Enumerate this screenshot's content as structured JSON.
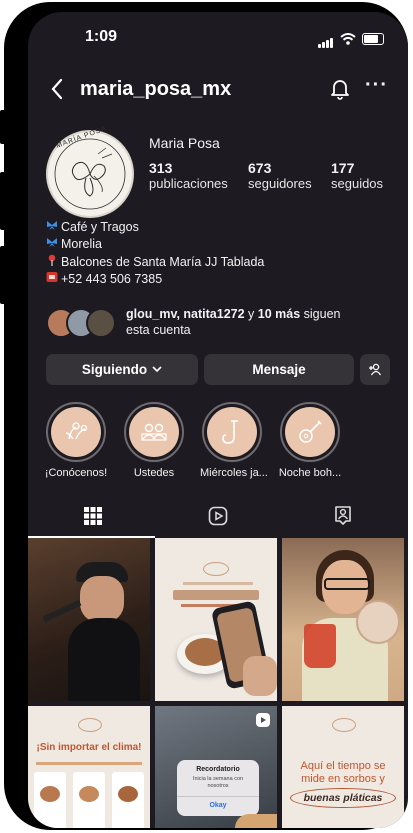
{
  "status_bar": {
    "time": "1:09"
  },
  "header": {
    "username": "maria_posa_mx"
  },
  "profile": {
    "name": "Maria Posa",
    "logo_text": "MARÍA POSA",
    "stats": [
      {
        "count": "313",
        "label": "publicaciones"
      },
      {
        "count": "673",
        "label": "seguidores"
      },
      {
        "count": "177",
        "label": "seguidos"
      }
    ],
    "bio": [
      {
        "icon": "butterfly-icon",
        "text": "Café y Tragos"
      },
      {
        "icon": "butterfly-icon",
        "text": "Morelia"
      },
      {
        "icon": "pin-icon",
        "text": "Balcones de Santa María JJ Tablada"
      },
      {
        "icon": "phone-icon",
        "text": "+52 443 506 7385"
      }
    ],
    "followed_by": {
      "names": "glou_mv, natita1272",
      "connector": " y ",
      "more": "10 más",
      "suffix": " siguen",
      "line2": "esta cuenta"
    }
  },
  "actions": {
    "following_label": "Siguiendo",
    "message_label": "Mensaje"
  },
  "highlights": [
    {
      "label": "¡Conócenos!",
      "icon": "flowers-icon"
    },
    {
      "label": "Ustedes",
      "icon": "people-icon"
    },
    {
      "label": "Miércoles ja...",
      "icon": "saxophone-icon"
    },
    {
      "label": "Noche boh...",
      "icon": "guitar-icon"
    }
  ],
  "tabs": [
    {
      "icon": "grid-icon",
      "active": true
    },
    {
      "icon": "reels-icon",
      "active": false
    },
    {
      "icon": "tagged-icon",
      "active": false
    }
  ],
  "posts": [
    {
      "type": "photo-singer"
    },
    {
      "type": "promo-coffee"
    },
    {
      "type": "photo-woman-drink"
    },
    {
      "type": "promo-weather",
      "headline": "¡Sin importar el clima!"
    },
    {
      "type": "reel-reminder",
      "alert_title": "Recordatorio",
      "alert_body": "Inicia la semana con nosotros",
      "alert_button": "Okay"
    },
    {
      "type": "quote",
      "line1": "Aquí el tiempo se",
      "line2": "mide en sorbos y",
      "emphasis": "buenas pláticas"
    }
  ]
}
